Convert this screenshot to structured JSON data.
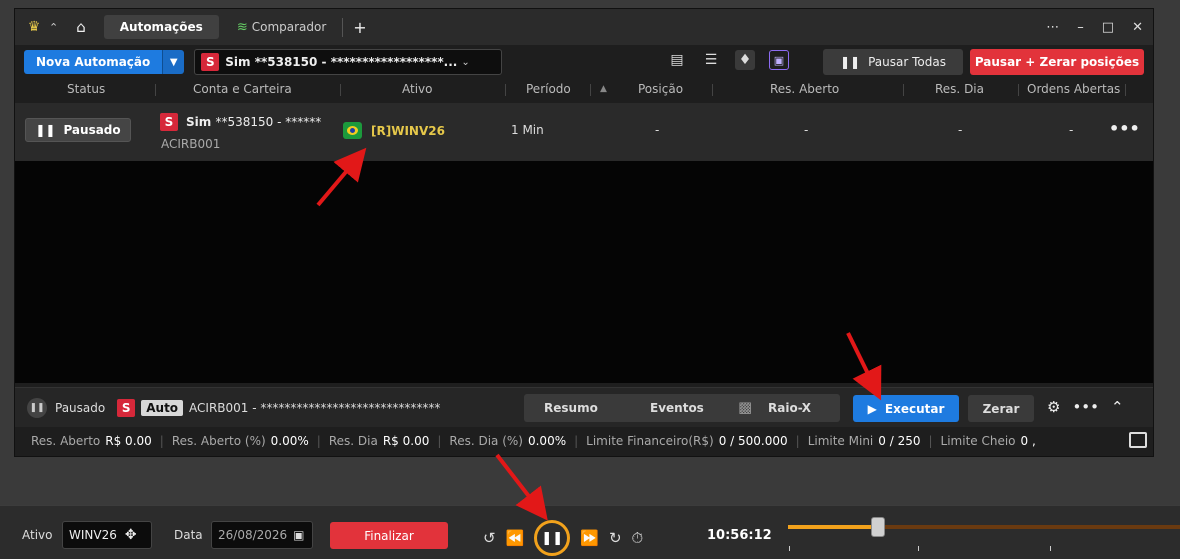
{
  "titlebar": {
    "tabs": [
      {
        "label": "Automações"
      },
      {
        "label": "Comparador"
      }
    ]
  },
  "toolbar": {
    "nova_label": "Nova Automação",
    "account_badge": "S",
    "account_text": "Sim **538150 - ******************...",
    "pausar_todas_label": "Pausar Todas",
    "pausar_zerar_label": "Pausar + Zerar posições"
  },
  "columns": {
    "status": "Status",
    "conta": "Conta e Carteira",
    "ativo": "Ativo",
    "periodo": "Período",
    "posicao": "Posição",
    "res_aberto": "Res. Aberto",
    "res_dia": "Res. Dia",
    "ordens": "Ordens Abertas"
  },
  "row": {
    "status_label": "Pausado",
    "account_badge": "S",
    "account_sim": "Sim",
    "account_masked": "**538150 - ******",
    "carteira": "ACIRB001",
    "ativo": "[R]WINV26",
    "periodo": "1 Min",
    "posicao": "-",
    "res_aberto": "-",
    "res_dia": "-",
    "ordens": "-"
  },
  "statusbar": {
    "status": "Pausado",
    "badge_s": "S",
    "badge_auto": "Auto",
    "account": "ACIRB001 - ******************************",
    "resumo": "Resumo",
    "eventos": "Eventos",
    "raiox": "Raio-X",
    "executar": "Executar",
    "zerar": "Zerar"
  },
  "metrics": [
    {
      "label": "Res. Aberto",
      "value": "R$ 0.00"
    },
    {
      "label": "Res. Aberto (%)",
      "value": "0.00%"
    },
    {
      "label": "Res. Dia",
      "value": "R$ 0.00"
    },
    {
      "label": "Res. Dia (%)",
      "value": "0.00%"
    },
    {
      "label": "Limite Financeiro(R$)",
      "value": "0 / 500.000"
    },
    {
      "label": "Limite Mini",
      "value": "0 / 250"
    },
    {
      "label": "Limite Cheio",
      "value": "0 ,"
    }
  ],
  "bottombar": {
    "ativo_label": "Ativo",
    "ativo_value": "WINV26",
    "data_label": "Data",
    "data_value": "26/08/2026",
    "finalizar_label": "Finalizar",
    "clock": "10:56:12",
    "progress": 0.23
  },
  "colors": {
    "accent_blue": "#1e7be0",
    "danger_red": "#e2333b",
    "highlight_orange": "#f2a21c",
    "ativo_yellow": "#e6c84a"
  }
}
